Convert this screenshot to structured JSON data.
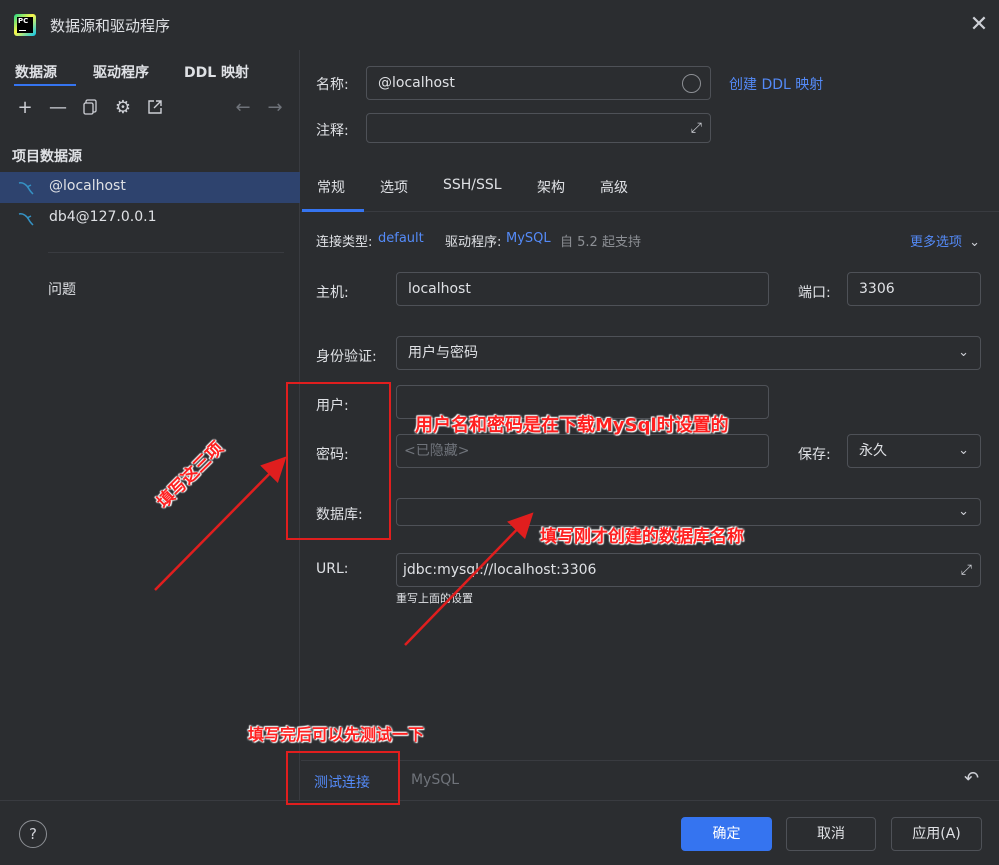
{
  "window": {
    "title": "数据源和驱动程序",
    "logo_text": "PC"
  },
  "left_tabs": [
    "数据源",
    "驱动程序",
    "DDL 映射"
  ],
  "toolbar_icons": [
    "add-icon",
    "remove-icon",
    "copy-icon",
    "gear-icon",
    "export-icon",
    "back-arrow-icon",
    "forward-arrow-icon"
  ],
  "sidebar": {
    "section_title": "项目数据源",
    "items": [
      {
        "label": "@localhost",
        "selected": true
      },
      {
        "label": "db4@127.0.0.1",
        "selected": false
      }
    ],
    "problems": "问题"
  },
  "form": {
    "name_label": "名称:",
    "name_value": "@localhost",
    "create_ddl_link": "创建 DDL 映射",
    "comment_label": "注释:",
    "comment_value": ""
  },
  "main_tabs": [
    "常规",
    "选项",
    "SSH/SSL",
    "架构",
    "高级"
  ],
  "info_row": {
    "conn_type_label": "连接类型:",
    "conn_type_value": "default",
    "driver_label": "驱动程序:",
    "driver_value": "MySQL",
    "driver_note": "自 5.2 起支持",
    "more_options": "更多选项"
  },
  "fields": {
    "host_label": "主机:",
    "host_value": "localhost",
    "port_label": "端口:",
    "port_value": "3306",
    "auth_label": "身份验证:",
    "auth_value": "用户与密码",
    "user_label": "用户:",
    "user_value": "",
    "password_label": "密码:",
    "password_placeholder": "<已隐藏>",
    "save_label": "保存:",
    "save_value": "永久",
    "database_label": "数据库:",
    "database_value": "",
    "url_label": "URL:",
    "url_value": "jdbc:mysql://localhost:3306",
    "url_hint": "重写上面的设置"
  },
  "bottom": {
    "test_connection": "测试连接",
    "driver_name": "MySQL"
  },
  "footer": {
    "ok": "确定",
    "cancel": "取消",
    "apply": "应用(A)",
    "help": "?"
  },
  "annotations": {
    "fill_three": "填写这三项",
    "user_pass_note": "用户名和密码是在下载MySql时设置的",
    "db_name_note": "填写刚才创建的数据库名称",
    "test_note": "填写完后可以先测试一下"
  },
  "colors": {
    "background": "#2b2d30",
    "accent": "#3574f0",
    "link": "#548af7",
    "annotation": "#e01e1e",
    "selection": "#2e436e"
  }
}
